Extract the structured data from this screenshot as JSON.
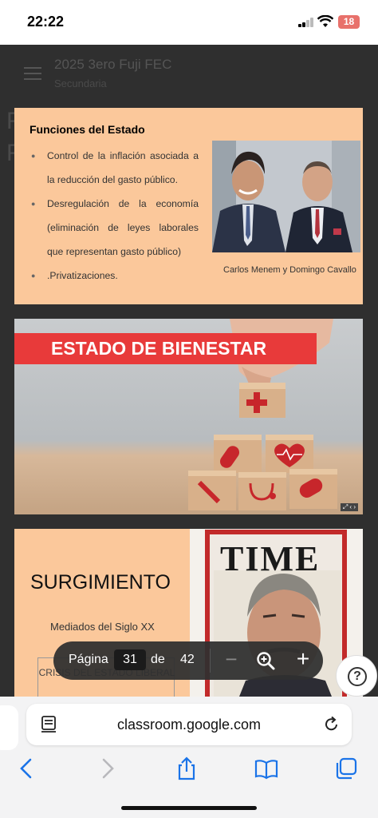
{
  "status_bar": {
    "time": "22:22",
    "battery": "18"
  },
  "classroom": {
    "title": "2025 3ero Fuji FEC",
    "subtitle": "Secundaria"
  },
  "slide1": {
    "title": "Funciones del Estado",
    "bullets": [
      "Control de la inflación asociada a la reducción del gasto público.",
      "Desregulación de la economía (eliminación de leyes laborales que representan gasto público)",
      ".Privatizaciones."
    ],
    "caption": "Carlos Menem y Domingo Cavallo"
  },
  "slide2": {
    "title": "ESTADO DE BIENESTAR"
  },
  "slide3": {
    "title": "SURGIMIENTO",
    "subtitle": "Mediados del Siglo XX",
    "box_text": "CRISIS DEL ESTADO LIBERAL",
    "magazine": "TIME"
  },
  "page_controls": {
    "label": "Página",
    "current": "31",
    "of": "de",
    "total": "42"
  },
  "browser": {
    "url": "classroom.google.com"
  },
  "colors": {
    "slide_peach": "#fbc89b",
    "banner_red": "#e83a3a",
    "ios_blue": "#1a73e8"
  },
  "icons": [
    "menu-icon",
    "zoom-out-icon",
    "zoom-in-icon",
    "magnifier-icon",
    "help-icon",
    "page-settings-icon",
    "reload-icon",
    "back-icon",
    "forward-icon",
    "share-icon",
    "bookmarks-icon",
    "tabs-icon"
  ]
}
